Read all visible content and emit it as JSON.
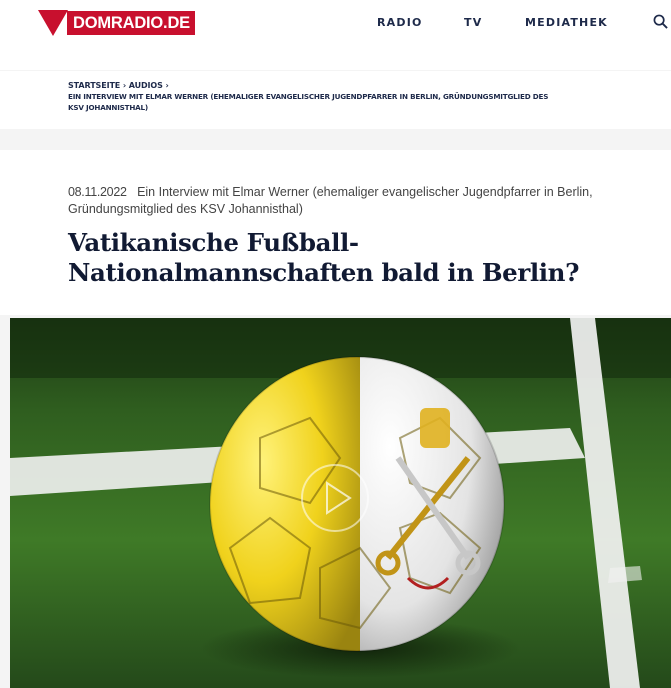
{
  "brand": {
    "logo_text": "DOMRADIO.DE"
  },
  "nav": {
    "items": [
      "RADIO",
      "TV",
      "MEDIATHEK"
    ]
  },
  "breadcrumb": {
    "home": "STARTSEITE ›",
    "section": "AUDIOS ›",
    "current_line1": "EIN INTERVIEW MIT ELMAR WERNER (EHEMALIGER EVANGELISCHER JUGENDPFARRER IN BERLIN, GRÜNDUNGSMITGLIED DES",
    "current_line2": "KSV JOHANNISTHAL)"
  },
  "article": {
    "date": "08.11.2022",
    "teaser_line1": "Ein Interview mit Elmar Werner (ehemaliger evangelischer Jugendpfarrer in Berlin,",
    "teaser_line2": "Gründungsmitglied des KSV Johannisthal)",
    "title_line1": "Vatikanische Fußball-",
    "title_line2": "Nationalmannschaften bald in Berlin?"
  },
  "colors": {
    "brand_red": "#c8102e",
    "nav_text": "#1e2a4a",
    "title": "#111a33"
  },
  "icons": {
    "search": "search-icon",
    "play": "play-icon"
  }
}
